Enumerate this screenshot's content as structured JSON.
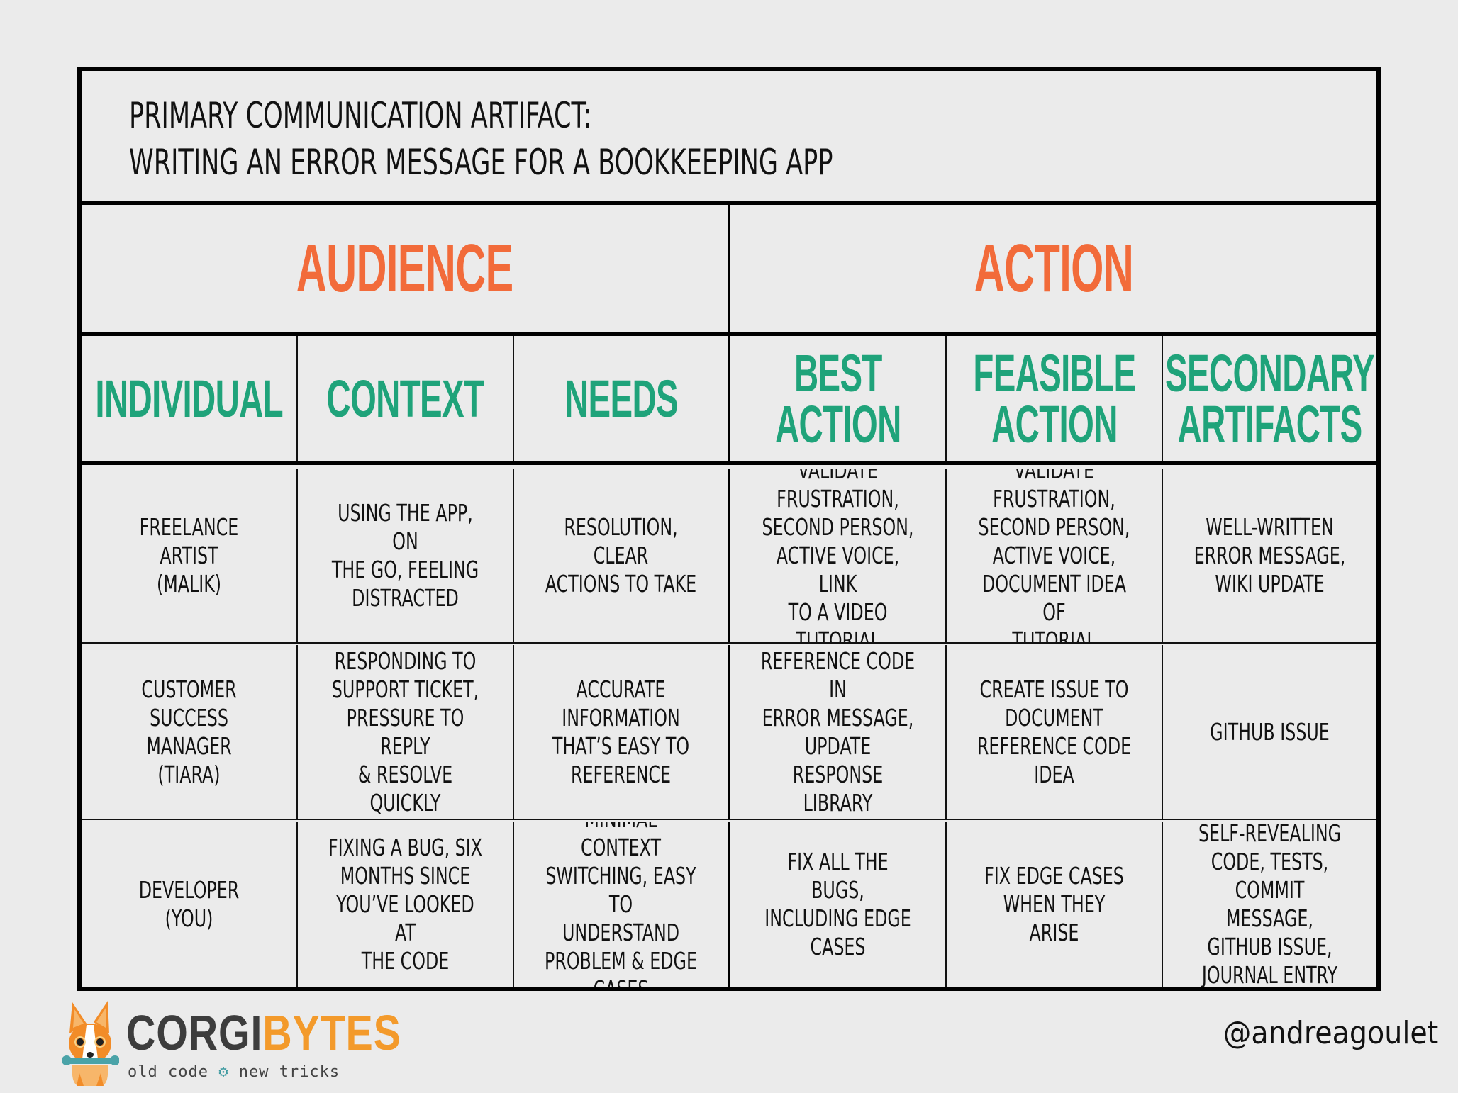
{
  "title": {
    "line1": "PRIMARY COMMUNICATION ARTIFACT:",
    "line2": "WRITING AN ERROR MESSAGE FOR A BOOKKEEPING APP"
  },
  "sections": {
    "audience": "AUDIENCE",
    "action": "ACTION"
  },
  "columns": [
    "INDIVIDUAL",
    "CONTEXT",
    "NEEDS",
    "BEST\nACTION",
    "FEASIBLE\nACTION",
    "SECONDARY\nARTIFACTS"
  ],
  "rows": [
    [
      "FREELANCE ARTIST\n(MALIK)",
      "USING THE APP, ON\nTHE GO, FEELING\nDISTRACTED",
      "RESOLUTION, CLEAR\nACTIONS TO TAKE",
      "VALIDATE\nFRUSTRATION,\nSECOND PERSON,\nACTIVE VOICE, LINK\nTO A VIDEO\nTUTORIAL",
      "VALIDATE\nFRUSTRATION,\nSECOND PERSON,\nACTIVE VOICE,\nDOCUMENT IDEA OF\nTUTORIAL",
      "WELL-WRITTEN\nERROR MESSAGE,\nWIKI UPDATE"
    ],
    [
      "CUSTOMER SUCCESS\nMANAGER\n(TIARA)",
      "RESPONDING TO\nSUPPORT TICKET,\nPRESSURE TO REPLY\n& RESOLVE QUICKLY",
      "ACCURATE\nINFORMATION\nTHAT’S EASY TO\nREFERENCE",
      "REFERENCE CODE IN\nERROR MESSAGE,\nUPDATE RESPONSE\nLIBRARY",
      "CREATE ISSUE TO\nDOCUMENT\nREFERENCE CODE\nIDEA",
      "GITHUB ISSUE"
    ],
    [
      "DEVELOPER\n(YOU)",
      "FIXING A BUG, SIX\nMONTHS SINCE\nYOU’VE LOOKED AT\nTHE CODE",
      "MINIMAL CONTEXT\nSWITCHING, EASY TO\nUNDERSTAND\nPROBLEM & EDGE\nCASES",
      "FIX ALL THE BUGS,\nINCLUDING EDGE\nCASES",
      "FIX EDGE CASES\nWHEN THEY ARISE",
      "SELF-REVEALING\nCODE, TESTS,\nCOMMIT MESSAGE,\nGITHUB ISSUE,\nJOURNAL ENTRY"
    ]
  ],
  "footer": {
    "brand_part1": "CORGI",
    "brand_part2": "BYTES",
    "tagline_left": "old code",
    "tagline_icon": "gear-icon",
    "tagline_right": "new tricks",
    "handle": "@andreagoulet"
  },
  "colors": {
    "section_header": "#f26b3a",
    "column_header": "#1fa37a",
    "brand_dark": "#3d3d3d",
    "brand_orange": "#f39a2b",
    "gear_teal": "#3e9aa0",
    "background": "#ebebeb"
  }
}
